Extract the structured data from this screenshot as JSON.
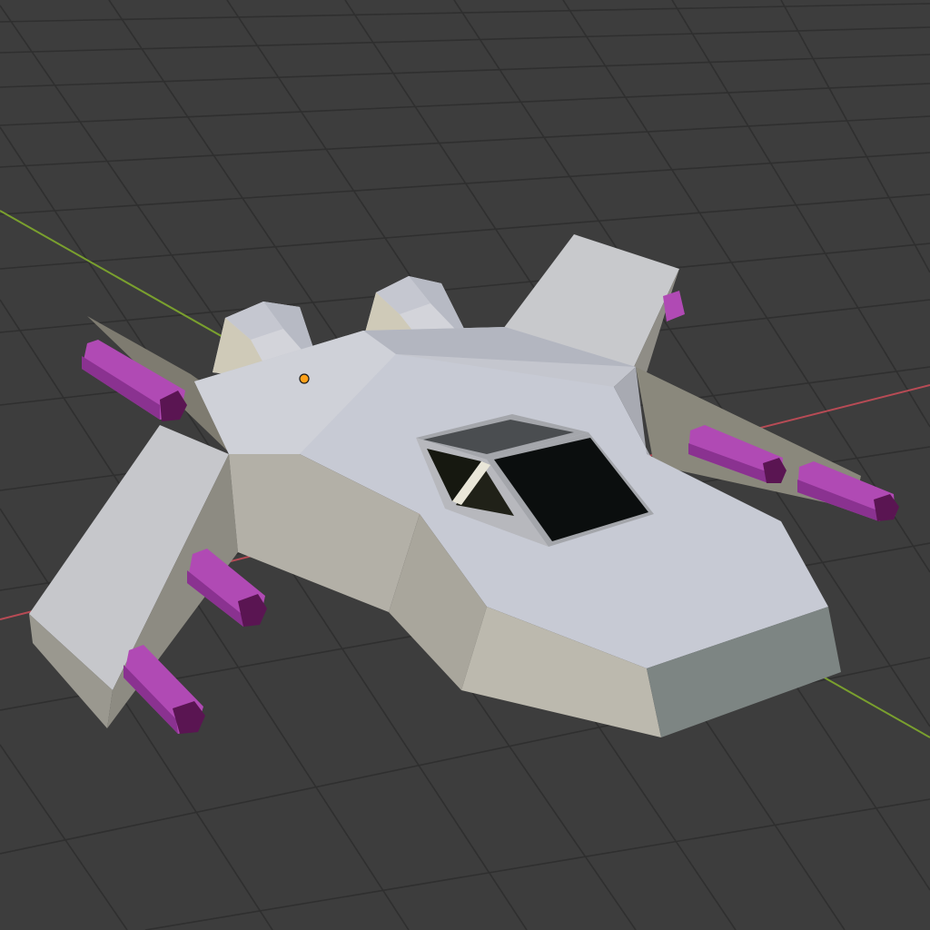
{
  "viewport": {
    "background_color": "#3d3d3d",
    "grid_color": "#2f2f2f",
    "x_axis_color": "#b84b55",
    "y_axis_color": "#7aa02e"
  },
  "model": {
    "hull_light_color": "#c9ccd6",
    "hull_mid_color": "#b9bcc5",
    "hull_shadow_color": "#a8a69e",
    "wing_color": "#c8c9cc",
    "engine_color": "#b04ab4",
    "engine_cap_color": "#5a1552",
    "cockpit_glass_color": "#0b0e0e",
    "origin_marker_color": "#ffa11a"
  }
}
